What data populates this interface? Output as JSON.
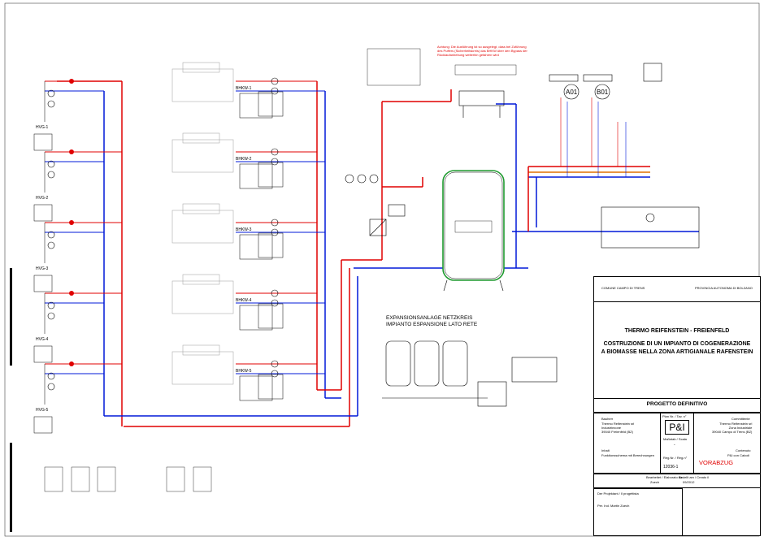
{
  "drawing": {
    "colors": {
      "supply": "#e00000",
      "return": "#0018d8",
      "line": "#000000",
      "green": "#1f9a2f",
      "orange": "#e07000"
    },
    "units": [
      {
        "tag": "BHKW-1",
        "boiler": "HVG-1"
      },
      {
        "tag": "BHKW-2",
        "boiler": "HVG-2"
      },
      {
        "tag": "BHKW-3",
        "boiler": "HVG-3"
      },
      {
        "tag": "BHKW-4",
        "boiler": "HVG-4"
      },
      {
        "tag": "BHKW-5",
        "boiler": "HVG-5"
      }
    ],
    "consumers": [
      "A01",
      "B01"
    ],
    "expansion_title_de": "EXPANSIONSANLAGE NETZKREIS",
    "expansion_title_it": "IMPIANTO ESPANSIONE LATO RETE",
    "warning_note": "Achtung: Die Ausführung ist so ausgelegt, dass bei Zuführung des Puffers (Sicherheitskreis) das BHKW über den Bypass der Rücklaufanhebung weiterhin gefahren wird"
  },
  "title_block": {
    "municipality": "COMUNE CAMPO DI TRENS",
    "province": "PROVINCIA AUTONOMA DI BOLZANO",
    "project_name": "THERMO REIFENSTEIN - FREIENFELD",
    "project_desc_line1": "COSTRUZIONE DI UN IMPIANTO DI COGENERAZIONE",
    "project_desc_line2": "A BIOMASSE NELLA ZONA ARTIGIANALE RAFENSTEIN",
    "phase": "PROGETTO DEFINITIVO",
    "builder_label": "Bauherr",
    "builder": "Thermo Reifenstein srl\nIndustriezone\n39040 Freienfeld (BZ)",
    "client_label": "Committente",
    "client": "Thermo Reifenstein srl\nZona Industriale\n39040 Campo di Trens (BZ)",
    "doc_type": "P&I",
    "scale_label": "Maßstab / Scala",
    "scale": "-",
    "plan_no_label": "Plan Nr. / Tav. n°",
    "content_label": "Inhalt",
    "content": "Funktionsschema mit Berechnungen",
    "contents_label": "Contenuto",
    "contents": "P&I con Calcoli",
    "page_label": "Reg.Nr. / Reg.n°",
    "drawing_number": "12036-1",
    "stamp": "VORABZUG",
    "drawn_label": "Bearbeitet / Elaborato da",
    "drawn": "Zuech",
    "date_label": "Erstellt am / Creato il",
    "date": "09/2012",
    "planner_label": "Der Projektant / Il progettista",
    "planner": "Per. Ind. Martin Zuech"
  }
}
